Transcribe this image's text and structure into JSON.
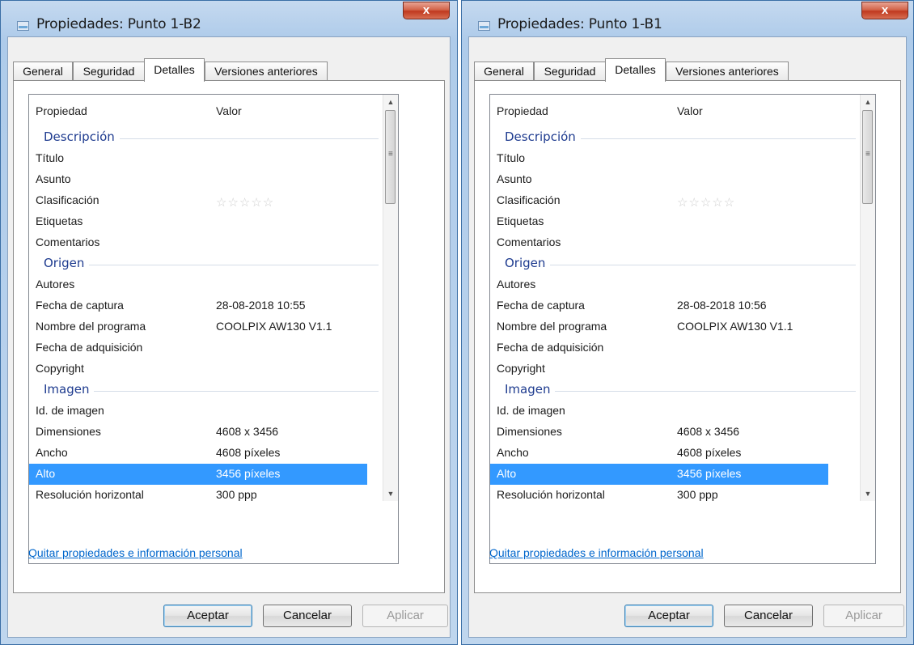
{
  "windows": [
    {
      "title": "Propiedades: Punto 1-B2",
      "close_label": "x",
      "tabs": [
        "General",
        "Seguridad",
        "Detalles",
        "Versiones anteriores"
      ],
      "active_tab": "Detalles",
      "columns": [
        "Propiedad",
        "Valor"
      ],
      "groups": {
        "descripcion": "Descripción",
        "origen": "Origen",
        "imagen": "Imagen"
      },
      "rows": {
        "titulo": "Título",
        "asunto": "Asunto",
        "clasificacion": "Clasificación",
        "etiquetas": "Etiquetas",
        "comentarios": "Comentarios",
        "autores": "Autores",
        "fecha_captura": "Fecha de captura",
        "nombre_programa": "Nombre del programa",
        "fecha_adquisicion": "Fecha de adquisición",
        "copyright": "Copyright",
        "id_imagen": "Id. de imagen",
        "dimensiones": "Dimensiones",
        "ancho": "Ancho",
        "alto": "Alto",
        "resolucion_horizontal": "Resolución horizontal"
      },
      "values": {
        "rating_stars": "☆☆☆☆☆",
        "fecha_captura": "28-08-2018 10:55",
        "nombre_programa": "COOLPIX AW130 V1.1",
        "dimensiones": "4608 x 3456",
        "ancho": "4608 píxeles",
        "alto": "3456 píxeles",
        "resolucion_horizontal": "300 ppp"
      },
      "selected_row": "Alto",
      "link": "Quitar propiedades e información personal",
      "buttons": {
        "ok": "Aceptar",
        "cancel": "Cancelar",
        "apply": "Aplicar"
      }
    },
    {
      "title": "Propiedades: Punto 1-B1",
      "close_label": "x",
      "tabs": [
        "General",
        "Seguridad",
        "Detalles",
        "Versiones anteriores"
      ],
      "active_tab": "Detalles",
      "columns": [
        "Propiedad",
        "Valor"
      ],
      "groups": {
        "descripcion": "Descripción",
        "origen": "Origen",
        "imagen": "Imagen"
      },
      "rows": {
        "titulo": "Título",
        "asunto": "Asunto",
        "clasificacion": "Clasificación",
        "etiquetas": "Etiquetas",
        "comentarios": "Comentarios",
        "autores": "Autores",
        "fecha_captura": "Fecha de captura",
        "nombre_programa": "Nombre del programa",
        "fecha_adquisicion": "Fecha de adquisición",
        "copyright": "Copyright",
        "id_imagen": "Id. de imagen",
        "dimensiones": "Dimensiones",
        "ancho": "Ancho",
        "alto": "Alto",
        "resolucion_horizontal": "Resolución horizontal"
      },
      "values": {
        "rating_stars": "☆☆☆☆☆",
        "fecha_captura": "28-08-2018 10:56",
        "nombre_programa": "COOLPIX AW130 V1.1",
        "dimensiones": "4608 x 3456",
        "ancho": "4608 píxeles",
        "alto": "3456 píxeles",
        "resolucion_horizontal": "300 ppp"
      },
      "selected_row": "Alto",
      "link": "Quitar propiedades e información personal",
      "buttons": {
        "ok": "Aceptar",
        "cancel": "Cancelar",
        "apply": "Aplicar"
      }
    }
  ],
  "colors": {
    "selection": "#3399ff",
    "group_heading": "#1e3b8f",
    "link": "#0066cc"
  }
}
